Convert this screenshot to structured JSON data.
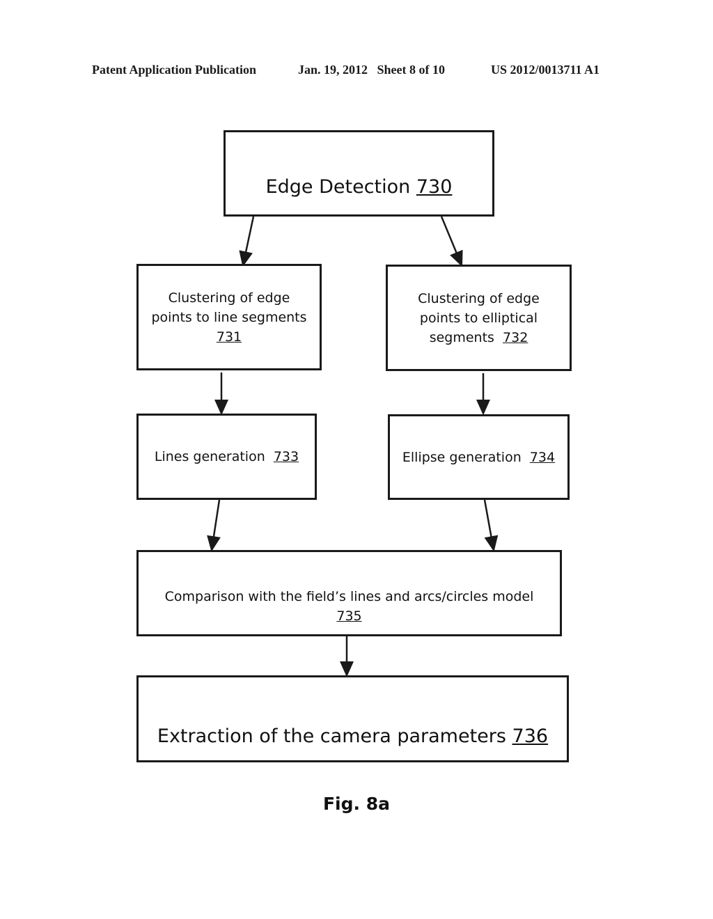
{
  "header": {
    "publication": "Patent Application Publication",
    "date_sheet": "Jan. 19, 2012   Sheet 8 of 10",
    "number": "US 2012/0013711 A1"
  },
  "nodes": {
    "n730": {
      "text": "Edge Detection",
      "ref": "730"
    },
    "n731": {
      "line1": "Clustering of edge",
      "line2": "points to line segments",
      "ref": "731"
    },
    "n732": {
      "line1": "Clustering of edge",
      "line2": "points to elliptical",
      "line3": "segments",
      "ref": "732"
    },
    "n733": {
      "text": "Lines generation",
      "ref": "733"
    },
    "n734": {
      "text": "Ellipse generation",
      "ref": "734"
    },
    "n735": {
      "text": "Comparison with the field’s lines and arcs/circles model",
      "ref": "735"
    },
    "n736": {
      "text": "Extraction of the camera parameters",
      "ref": "736"
    }
  },
  "edges": [
    {
      "from": "730",
      "to": "731"
    },
    {
      "from": "730",
      "to": "732"
    },
    {
      "from": "731",
      "to": "733"
    },
    {
      "from": "732",
      "to": "734"
    },
    {
      "from": "733",
      "to": "735"
    },
    {
      "from": "734",
      "to": "735"
    },
    {
      "from": "735",
      "to": "736"
    }
  ],
  "figure_label": "Fig. 8a"
}
